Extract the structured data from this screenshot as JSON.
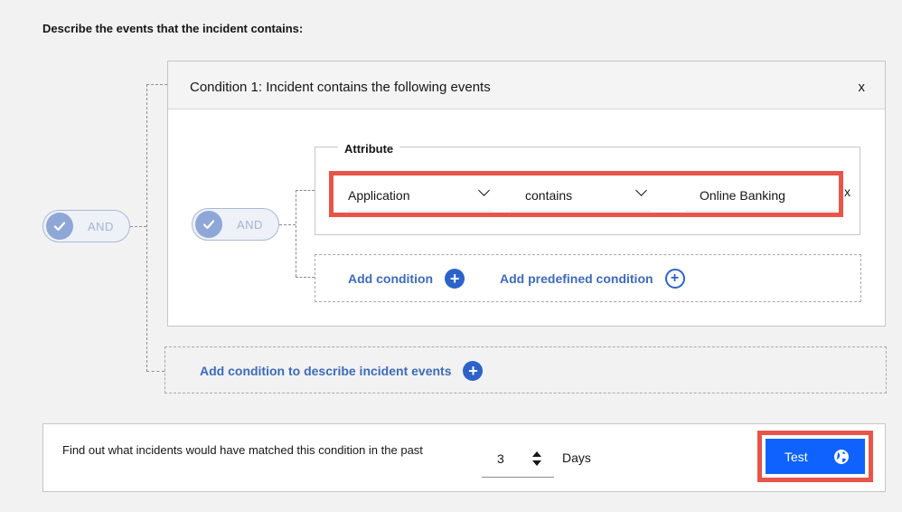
{
  "heading": "Describe the events that the incident contains:",
  "outer_toggle": {
    "label": "AND"
  },
  "condition": {
    "title": "Condition 1: Incident contains the following events",
    "close_label": "x",
    "inner_toggle": {
      "label": "AND"
    },
    "attribute": {
      "legend": "Attribute",
      "field": "Application",
      "operator": "contains",
      "value": "Online Banking",
      "remove_label": "x"
    },
    "add_condition_label": "Add condition",
    "add_predefined_label": "Add predefined condition"
  },
  "add_outer_condition_label": "Add condition to describe incident events",
  "find": {
    "text": "Find out what incidents would have matched this condition in the past",
    "days_value": "3",
    "days_label": "Days",
    "test_label": "Test"
  },
  "colors": {
    "accent": "#0f62fe",
    "link": "#3d6bb8",
    "highlight": "#e8544a"
  }
}
